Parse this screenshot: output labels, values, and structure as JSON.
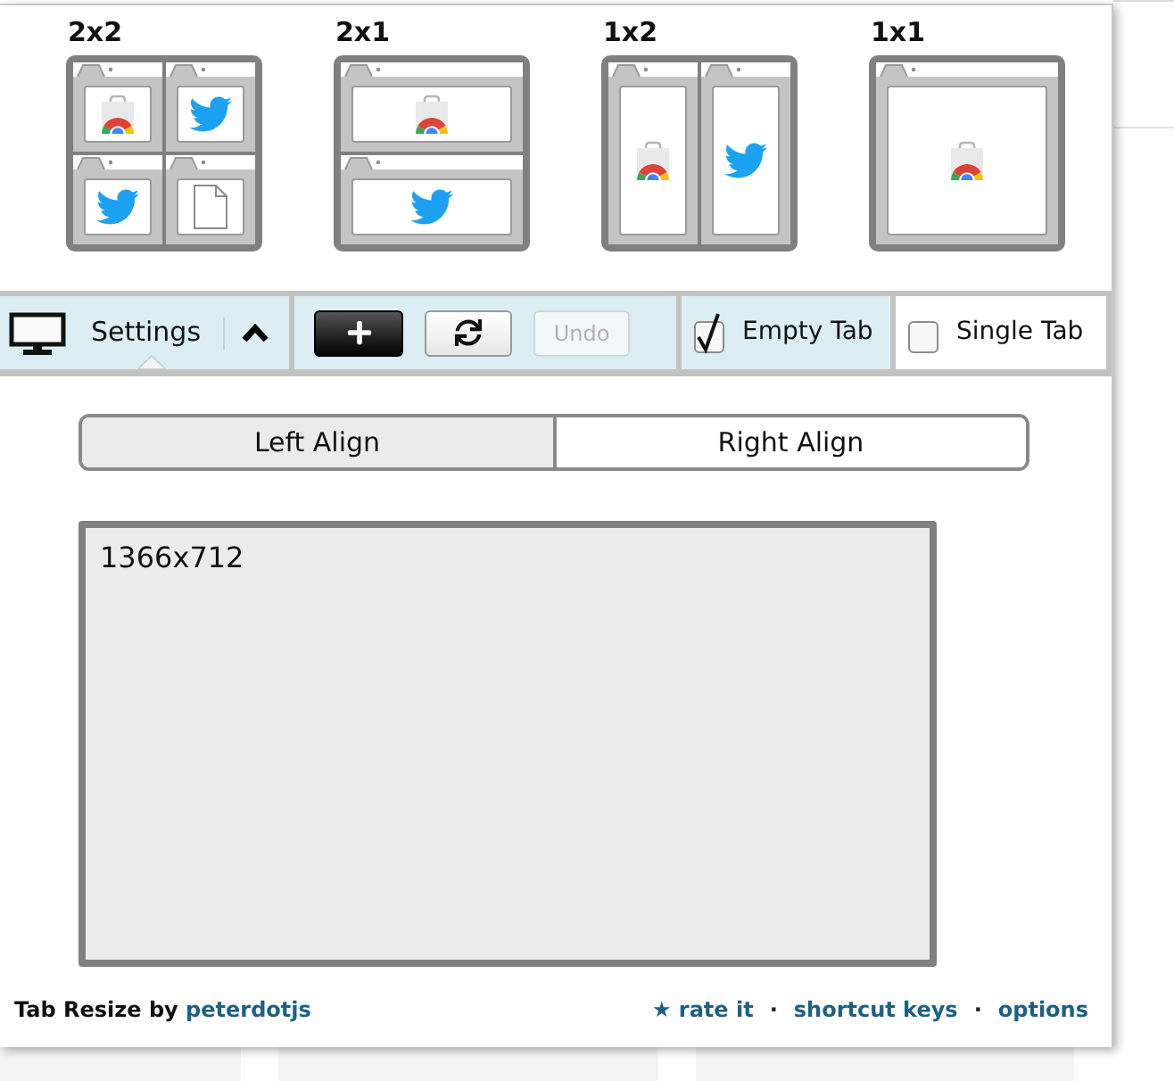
{
  "layouts": [
    {
      "label": "2x2",
      "rows": [
        {
          "panes": [
            {
              "kind": "store"
            },
            {
              "kind": "bird"
            }
          ]
        },
        {
          "panes": [
            {
              "kind": "bird"
            },
            {
              "kind": "file"
            }
          ]
        }
      ]
    },
    {
      "label": "2x1",
      "rows": [
        {
          "panes": [
            {
              "kind": "store"
            }
          ]
        },
        {
          "panes": [
            {
              "kind": "bird"
            }
          ]
        }
      ]
    },
    {
      "label": "1x2",
      "rows": [
        {
          "panes": [
            {
              "kind": "store"
            },
            {
              "kind": "bird"
            }
          ]
        }
      ]
    },
    {
      "label": "1x1",
      "rows": [
        {
          "panes": [
            {
              "kind": "store"
            }
          ]
        }
      ]
    }
  ],
  "toolbar": {
    "settings": {
      "label": "Settings",
      "expanded": true
    },
    "buttons": [
      {
        "kind": "add",
        "disabled": false
      },
      {
        "kind": "refresh",
        "disabled": false
      },
      {
        "kind": "undo",
        "label": "Undo",
        "disabled": true
      }
    ],
    "options": [
      {
        "label": "Empty Tab",
        "checked": true
      },
      {
        "label": "Single Tab",
        "checked": false
      }
    ]
  },
  "alignment": [
    {
      "label": "Left Align",
      "selected": true
    },
    {
      "label": "Right Align",
      "selected": false
    }
  ],
  "display": {
    "resolution": "1366x712"
  },
  "footer": {
    "credit": "Tab Resize by",
    "author": "peterdotjs",
    "links": [
      {
        "kind": "link",
        "text": "★ rate it"
      },
      {
        "kind": "separator",
        "text": "·"
      },
      {
        "kind": "link",
        "text": "shortcut keys"
      },
      {
        "kind": "separator",
        "text": "·"
      },
      {
        "kind": "link",
        "text": "options"
      }
    ]
  }
}
